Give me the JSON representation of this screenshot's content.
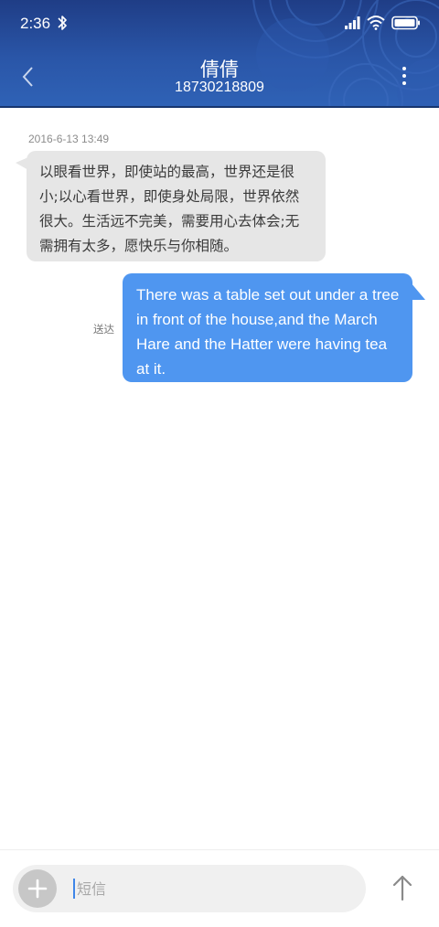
{
  "status_bar": {
    "time": "2:36",
    "icons": [
      "bluetooth-icon",
      "signal-icon",
      "wifi-icon",
      "battery-icon"
    ]
  },
  "header": {
    "contact_name": "倩倩",
    "contact_number": "18730218809",
    "back_icon": "chevron-left-icon",
    "more_icon": "more-vertical-icon"
  },
  "conversation": {
    "timestamp": "2016-6-13 13:49",
    "incoming_message": "以眼看世界，即使站的最高，世界还是很小;以心看世界，即使身处局限，世界依然很大。生活远不完美，需要用心去体会;无需拥有太多，愿快乐与你相随。",
    "outgoing_message": "There was a table set out under a tree in front of the house,and the March Hare and the Hatter were having tea at it.",
    "delivery_status": "送达"
  },
  "composer": {
    "placeholder": "短信",
    "value": "",
    "add_icon": "plus-icon",
    "send_icon": "arrow-up-icon"
  },
  "colors": {
    "header_top": "#1f3d86",
    "header_bottom": "#2f62b6",
    "incoming_bubble": "#e6e6e6",
    "outgoing_bubble": "#4f96f0",
    "caret": "#3f86e8"
  }
}
